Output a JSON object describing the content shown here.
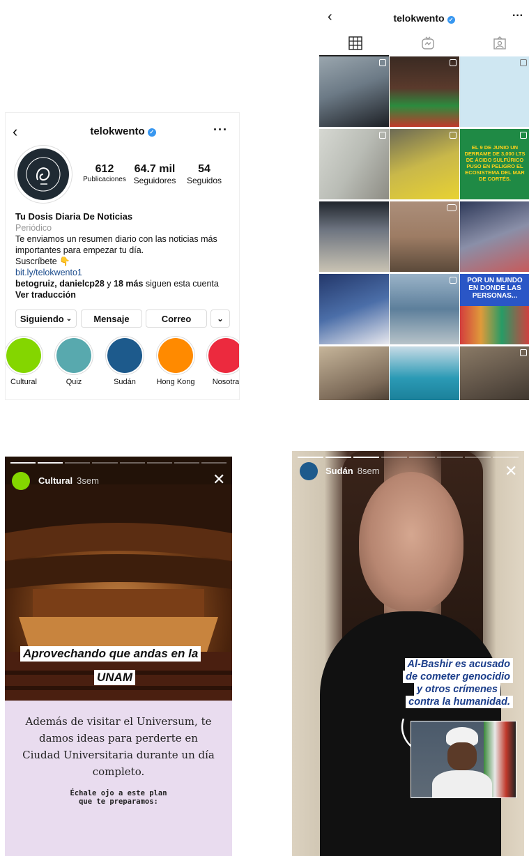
{
  "profile": {
    "username": "telokwento",
    "stats": [
      {
        "value": "612",
        "label": "Publicaciones"
      },
      {
        "value": "64.7 mil",
        "label": "Seguidores"
      },
      {
        "value": "54",
        "label": "Seguidos"
      }
    ],
    "name": "Tu Dosis Diaria De Noticias",
    "category": "Periódico",
    "bio": "Te enviamos un resumen diario con las noticias más importantes para empezar tu día.",
    "subscribe": "Suscríbete 👇",
    "link": "bit.ly/telokwento1",
    "followed_by": {
      "users": "betogruiz, danielcp28",
      "joiner": " y ",
      "more": "18 más",
      "suffix": " siguen esta cuenta"
    },
    "translate": "Ver traducción",
    "buttons": {
      "following": "Siguiendo",
      "message": "Mensaje",
      "email": "Correo"
    },
    "highlights": [
      {
        "label": "Cultural",
        "color": "#84d600"
      },
      {
        "label": "Quiz",
        "color": "#58a9ae"
      },
      {
        "label": "Sudán",
        "color": "#1d5a8c"
      },
      {
        "label": "Hong Kong",
        "color": "#ff8a00"
      },
      {
        "label": "Nosotra",
        "color": "#ec2a3e"
      }
    ]
  },
  "grid_view": {
    "username": "telokwento",
    "tabs": [
      "grid-icon",
      "igtv-icon",
      "tagged-icon"
    ],
    "posts": [
      {
        "color": "#6c7a86",
        "text": ""
      },
      {
        "color": "#5a3a2c",
        "text": ""
      },
      {
        "color": "#cfe7f2",
        "text": ""
      },
      {
        "color": "#b9bcb5",
        "text": ""
      },
      {
        "color": "#b09c55",
        "text": ""
      },
      {
        "color": "#1f8a45",
        "text": "El 9 de junio un derrame de 3,000 lts de ácido sulfúrico puso en peligro el ecosistema del Mar de Cortés."
      },
      {
        "color": "#6d7480",
        "text": ""
      },
      {
        "color": "#9d7c64",
        "text": ""
      },
      {
        "color": "#8a8fa8",
        "text": ""
      },
      {
        "color": "#4b6ea8",
        "text": ""
      },
      {
        "color": "#5d7f9b",
        "text": ""
      },
      {
        "color": "#2a56c6",
        "text": "Por un mundo en donde las personas..."
      },
      {
        "color": "#7c6a58",
        "text": ""
      },
      {
        "color": "#2b9ab5",
        "text": ""
      },
      {
        "color": "#5e5246",
        "text": ""
      }
    ]
  },
  "story_cultural": {
    "user": "Cultural",
    "time": "3sem",
    "caption_line1": "Aprovechando que andas en la",
    "caption_line2": "UNAM",
    "body": "Además de visitar el Universum, te damos ideas para perderte en Ciudad Universitaria durante un día completo.",
    "note": "Échale ojo a este plan\nque te preparamos:"
  },
  "story_sudan": {
    "user": "Sudán",
    "time": "8sem",
    "caption": [
      "Al-Bashir es acusado",
      "de cometer genocidio",
      "y otros crímenes",
      "contra la humanidad."
    ]
  }
}
